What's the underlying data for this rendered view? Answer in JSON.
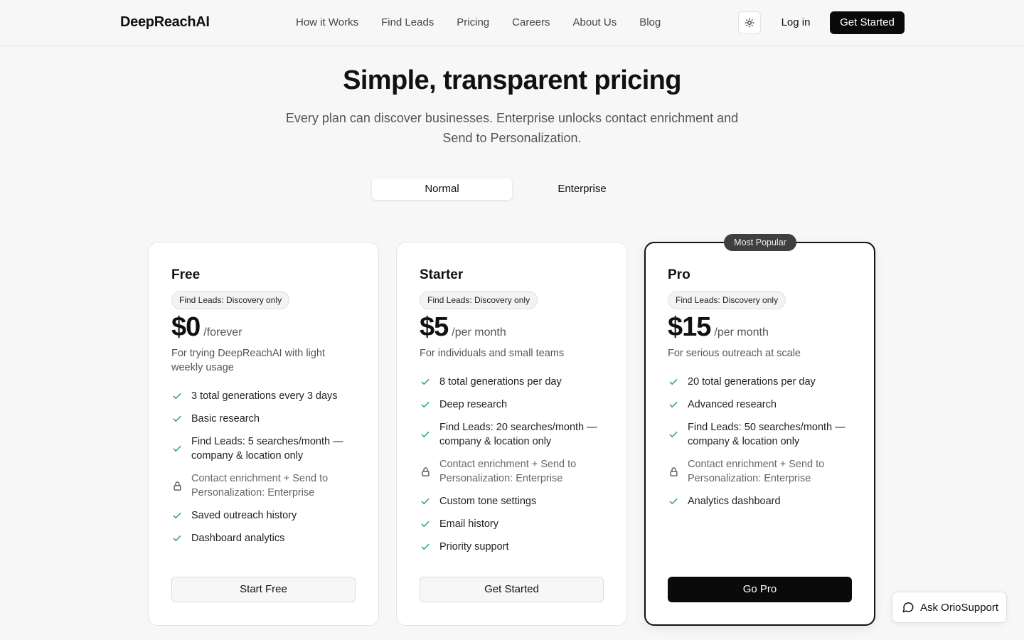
{
  "header": {
    "logo": "DeepReachAI",
    "nav": [
      "How it Works",
      "Find Leads",
      "Pricing",
      "Careers",
      "About Us",
      "Blog"
    ],
    "theme_icon": "sun-icon",
    "login_label": "Log in",
    "cta_label": "Get Started"
  },
  "hero": {
    "title": "Simple, transparent pricing",
    "subtitle": "Every plan can discover businesses. Enterprise unlocks contact enrichment and Send to Personalization."
  },
  "toggle": {
    "options": [
      "Normal",
      "Enterprise"
    ],
    "selected": "Normal"
  },
  "popular_badge": "Most Popular",
  "colors": {
    "check": "#22a06b",
    "primary": "#0a0a0a"
  },
  "plans": [
    {
      "name": "Free",
      "badge": "Find Leads: Discovery only",
      "price": "$0",
      "period": "/forever",
      "description": "For trying DeepReachAI with light weekly usage",
      "features": [
        {
          "text": "3 total generations every 3 days",
          "icon": "check-icon"
        },
        {
          "text": "Basic research",
          "icon": "check-icon"
        },
        {
          "text": "Find Leads: 5 searches/month — company & location only",
          "icon": "check-icon"
        },
        {
          "text": "Contact enrichment + Send to Personalization: Enterprise",
          "icon": "lock-icon"
        },
        {
          "text": "Saved outreach history",
          "icon": "check-icon"
        },
        {
          "text": "Dashboard analytics",
          "icon": "check-icon"
        }
      ],
      "cta": "Start Free"
    },
    {
      "name": "Starter",
      "badge": "Find Leads: Discovery only",
      "price": "$5",
      "period": "/per month",
      "description": "For individuals and small teams",
      "features": [
        {
          "text": "8 total generations per day",
          "icon": "check-icon"
        },
        {
          "text": "Deep research",
          "icon": "check-icon"
        },
        {
          "text": "Find Leads: 20 searches/month — company & location only",
          "icon": "check-icon"
        },
        {
          "text": "Contact enrichment + Send to Personalization: Enterprise",
          "icon": "lock-icon"
        },
        {
          "text": "Custom tone settings",
          "icon": "check-icon"
        },
        {
          "text": "Email history",
          "icon": "check-icon"
        },
        {
          "text": "Priority support",
          "icon": "check-icon"
        }
      ],
      "cta": "Get Started"
    },
    {
      "name": "Pro",
      "badge": "Find Leads: Discovery only",
      "price": "$15",
      "period": "/per month",
      "description": "For serious outreach at scale",
      "features": [
        {
          "text": "20 total generations per day",
          "icon": "check-icon"
        },
        {
          "text": "Advanced research",
          "icon": "check-icon"
        },
        {
          "text": "Find Leads: 50 searches/month — company & location only",
          "icon": "check-icon"
        },
        {
          "text": "Contact enrichment + Send to Personalization: Enterprise",
          "icon": "lock-icon"
        },
        {
          "text": "Analytics dashboard",
          "icon": "check-icon"
        }
      ],
      "cta": "Go Pro"
    }
  ],
  "support": {
    "label": "Ask OrioSupport",
    "icon": "chat-bubble-icon"
  }
}
